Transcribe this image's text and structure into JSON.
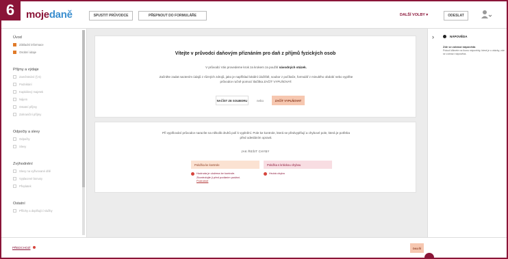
{
  "step_badge": "6",
  "logo": {
    "part1": "moje",
    "part2": "daně"
  },
  "header": {
    "btn_guide": "SPUSTIT PRŮVODCE",
    "btn_form": "PŘEPNOUT DO FORMULÁŘE",
    "more_years": "DALŠÍ VOLBY",
    "btn_submit": "ODESLAT"
  },
  "sidebar": {
    "sections": [
      {
        "title": "Úvod",
        "items": [
          {
            "label": "Základní informace",
            "done": true
          },
          {
            "label": "Osobní údaje",
            "done": true
          }
        ]
      },
      {
        "title": "Příjmy a výdaje",
        "items": [
          {
            "label": "Zaměstnání (§ 6)",
            "done": false
          },
          {
            "label": "Podnikání",
            "done": false
          },
          {
            "label": "Kapitálový majetek",
            "done": false
          },
          {
            "label": "Nájem",
            "done": false
          },
          {
            "label": "Ostatní příjmy",
            "done": false
          },
          {
            "label": "Zahraniční příjmy",
            "done": false
          }
        ]
      },
      {
        "title": "Odpočty a slevy",
        "items": [
          {
            "label": "Odpočty",
            "done": false
          },
          {
            "label": "Slevy",
            "done": false
          }
        ]
      },
      {
        "title": "Zvýhodnění",
        "items": [
          {
            "label": "Slevy na vyživované dítě",
            "done": false
          },
          {
            "label": "Vyplacené bonusy",
            "done": false
          },
          {
            "label": "Přeplatek",
            "done": false
          }
        ]
      },
      {
        "title": "Ostatní",
        "items": [
          {
            "label": "Přílohy a doplňující služby",
            "done": false
          }
        ]
      }
    ]
  },
  "card1": {
    "title": "Vítejte v průvodci daňovým přiznáním pro daň z příjmů fyzických osob",
    "line1_pre": "V průvodci Vás provedeme krok za krokem za použití",
    "line1_bold": "návodných otázek.",
    "line2": "Začněte zadat nactením údajů z různých zdrojů, jako je například lokální úložiště, soubor z počítače, formulář z minulého období nebo vyplňte",
    "line3": "průvodce ručně pomocí tlačítka ZAČÍT VYPLŇOVAT.",
    "btn_load": "NAČÍST ZE SOUBORU",
    "or": "nebo",
    "btn_start": "ZAČÍT VYPLŇOVAT"
  },
  "card2": {
    "text1": "Při vyplňování průvodce narazíte na několik druhů polí k vyplnění. Pole ke kontrole, která se předvyplňují a chybové pole, která je potřeba",
    "text2": "před odesláním opravit.",
    "legend_title": "JAK ŘEŠIT CHYBY",
    "legend_check": "Položka ke kontrole",
    "legend_error": "Položka s kritickou chybou",
    "note_check": "Hodnota je uložena ke kontrole.",
    "note_check2": "Zkontrolujte ji před podáním podání.",
    "note_check_link": "Podrobné",
    "note_error": "Hrubá chyba"
  },
  "right_panel": {
    "title": "NÁPOVĚDA",
    "heading": "Zde se zobrazí nápověda",
    "text": "Pokud kliknete na ikonu nápovědy, která je u otázky, zde se zobrazí nápověda."
  },
  "bottom": {
    "left_link": "PŘEDCHOZÍ",
    "next": "DALŠÍ"
  },
  "colors": {
    "brand": "#8a1538",
    "accent": "#3a8ecf",
    "peach": "#f6c7b0"
  }
}
